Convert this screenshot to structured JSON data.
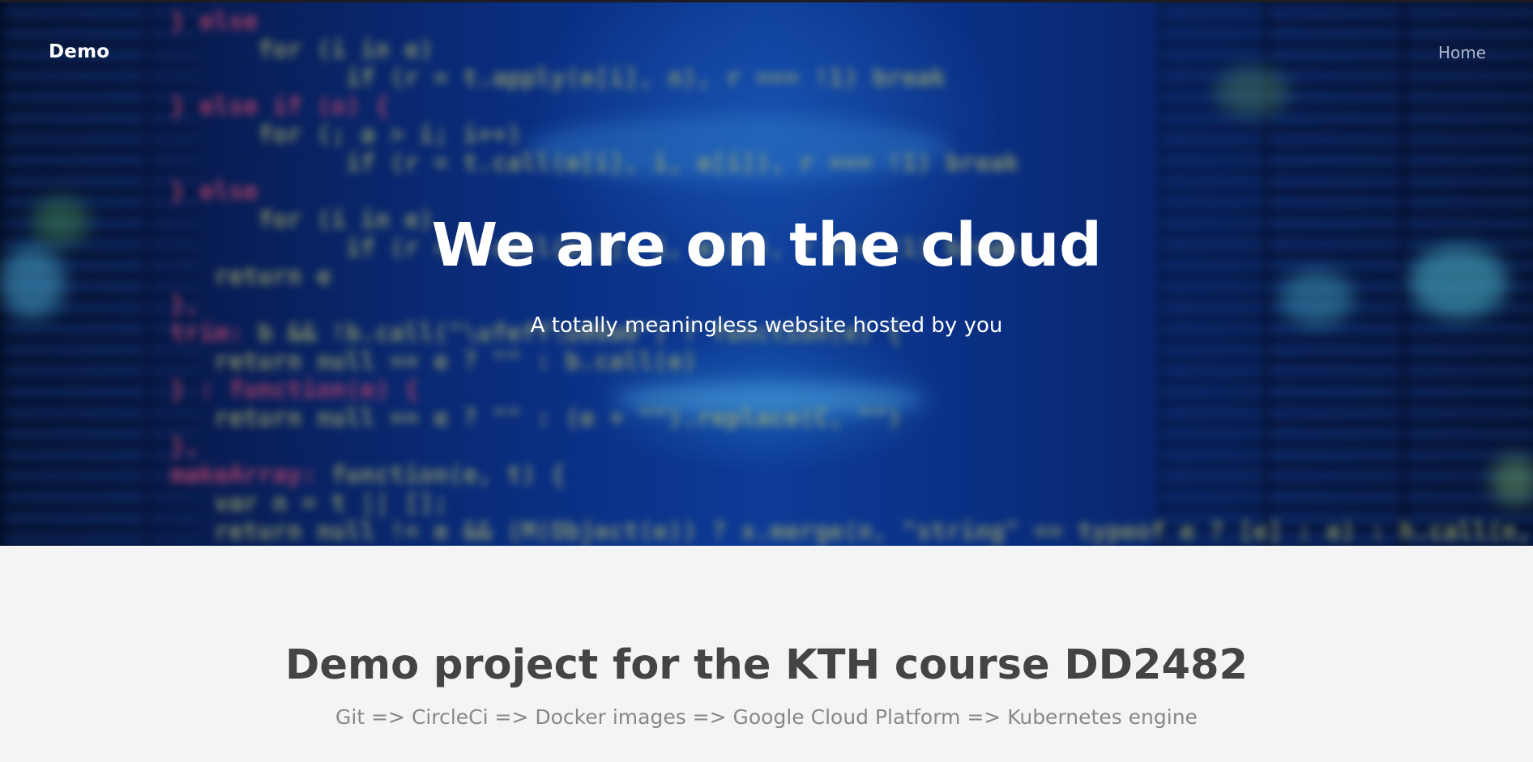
{
  "navbar": {
    "brand": "Demo",
    "links": [
      {
        "label": "Home"
      }
    ]
  },
  "hero": {
    "title": "We are on the cloud",
    "subtitle": "A totally meaningless website hosted by you",
    "background": "blurred-code-over-server-racks-image"
  },
  "section": {
    "title": "Demo project for the KTH course DD2482",
    "subtitle": "Git => CircleCi => Docker images => Google Cloud Platform => Kubernetes engine"
  },
  "colors": {
    "hero_text": "#ffffff",
    "nav_link": "#d0d4de",
    "section_background": "#f4f4f4",
    "section_title": "#444444",
    "section_subtitle": "#888888"
  }
}
